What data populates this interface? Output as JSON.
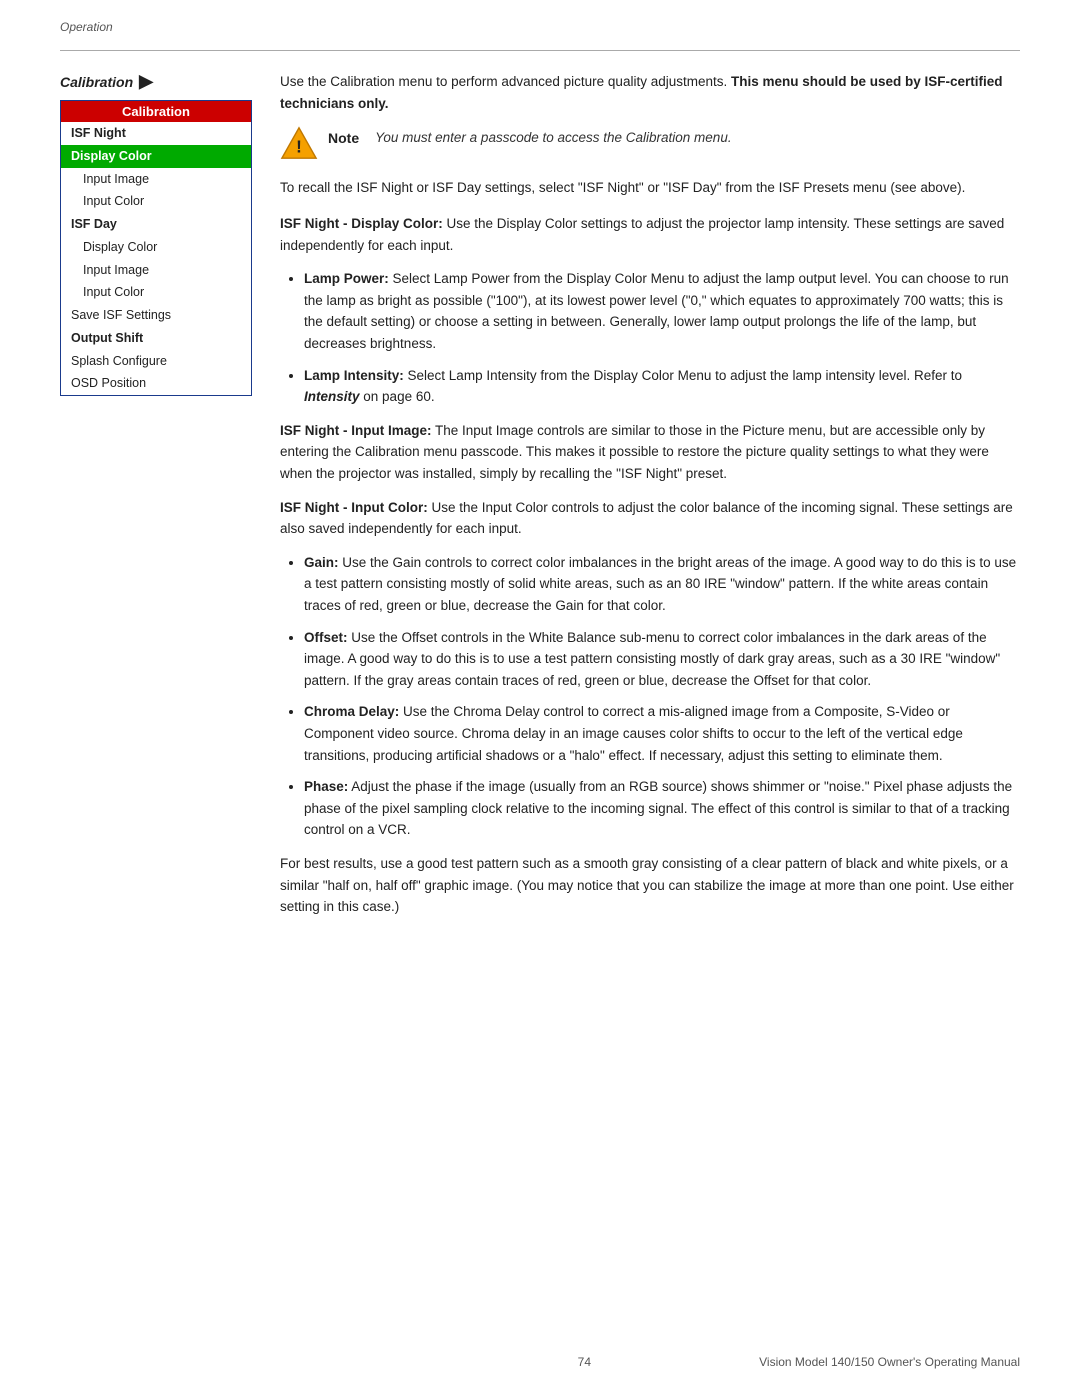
{
  "header": {
    "operation_label": "Operation"
  },
  "sidebar": {
    "calibration_label": "Calibration",
    "arrow": "▶",
    "menu_header": "Calibration",
    "items": [
      {
        "label": "ISF Night",
        "style": "bold"
      },
      {
        "label": "Display Color",
        "style": "highlighted"
      },
      {
        "label": "Input Image",
        "style": "indented"
      },
      {
        "label": "Input Color",
        "style": "indented"
      },
      {
        "label": "ISF Day",
        "style": "bold"
      },
      {
        "label": "Display Color",
        "style": "indented"
      },
      {
        "label": "Input Image",
        "style": "indented"
      },
      {
        "label": "Input Color",
        "style": "indented"
      },
      {
        "label": "Save ISF Settings",
        "style": "normal"
      },
      {
        "label": "Output Shift",
        "style": "bold"
      },
      {
        "label": "Splash Configure",
        "style": "normal"
      },
      {
        "label": "OSD Position",
        "style": "normal"
      }
    ]
  },
  "note": {
    "text": "You must enter a passcode to access the Calibration menu."
  },
  "main": {
    "calibration_intro": "Use the Calibration menu to perform advanced picture quality adjustments.",
    "calibration_bold": "This menu should be used by ISF-certified technicians only.",
    "recall_text": "To recall the ISF Night or ISF Day settings, select \"ISF Night\" or \"ISF Day\" from the ISF Presets menu (see above).",
    "section_isf_night_display_color_label": "ISF Night - Display Color:",
    "section_isf_night_display_color_text": "Use the Display Color settings to adjust the projector lamp intensity. These settings are saved independently for each input.",
    "bullet_lamp_power_label": "Lamp Power:",
    "bullet_lamp_power_text": "Select Lamp Power from the Display Color Menu to adjust the lamp output level. You can choose to run the lamp as bright as possible (\"100\"), at its lowest power level (\"0,\" which equates to approximately 700 watts; this is the default setting) or choose a setting in between. Generally, lower lamp output prolongs the life of the lamp, but decreases brightness.",
    "bullet_lamp_intensity_label": "Lamp Intensity:",
    "bullet_lamp_intensity_text": "Select Lamp Intensity from the Display Color Menu to adjust the lamp intensity level. Refer to",
    "bullet_lamp_intensity_italic": "Intensity",
    "bullet_lamp_intensity_suffix": "on page 60.",
    "section_isf_night_input_image_label": "ISF Night - Input Image:",
    "section_isf_night_input_image_text": "The Input Image controls are similar to those in the Picture menu, but are accessible only by entering the Calibration menu passcode. This makes it possible to restore the picture quality settings to what they were when the projector was installed, simply by recalling the \"ISF Night\" preset.",
    "section_isf_night_input_color_label": "ISF Night - Input Color:",
    "section_isf_night_input_color_text": "Use the Input Color controls to adjust the color balance of the incoming signal. These settings are also saved independently for each input.",
    "bullet_gain_label": "Gain:",
    "bullet_gain_text": "Use the Gain controls to correct color imbalances in the bright areas of the image. A good way to do this is to use a test pattern consisting mostly of solid white areas, such as an 80 IRE \"window\" pattern. If the white areas contain traces of red, green or blue, decrease the Gain for that color.",
    "bullet_offset_label": "Offset:",
    "bullet_offset_text": "Use the Offset controls in the White Balance sub-menu to correct color imbalances in the dark areas of the image. A good way to do this is to use a test pattern consisting mostly of dark gray areas, such as a 30 IRE \"window\" pattern. If the gray areas contain traces of red, green or blue, decrease the Offset for that color.",
    "bullet_chroma_delay_label": "Chroma Delay:",
    "bullet_chroma_delay_text": "Use the Chroma Delay control to correct a mis-aligned image from a Composite, S-Video or Component video source. Chroma delay in an image causes color shifts to occur to the left of the vertical edge transitions, producing artificial shadows or a \"halo\" effect. If necessary, adjust this setting to eliminate them.",
    "bullet_phase_label": "Phase:",
    "bullet_phase_text": "Adjust the phase if the image (usually from an RGB source) shows shimmer or \"noise.\" Pixel phase adjusts the phase of the pixel sampling clock relative to the incoming signal. The effect of this control is similar to that of a tracking control on a VCR.",
    "best_results_text": "For best results, use a good test pattern such as a smooth gray consisting of a clear pattern of black and white pixels, or a similar \"half on, half off\" graphic image. (You may notice that you can stabilize the image at more than one point. Use either setting in this case.)"
  },
  "footer": {
    "page_number": "74",
    "right_text": "Vision Model 140/150 Owner's Operating Manual"
  }
}
